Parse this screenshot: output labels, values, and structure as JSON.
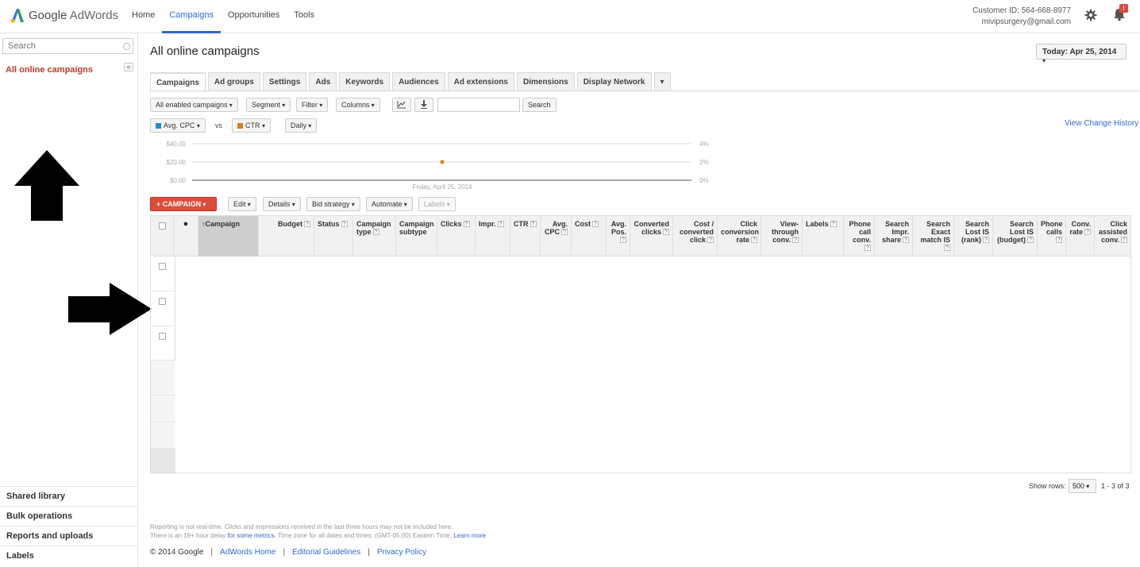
{
  "app": {
    "logo_text": "Google AdWords",
    "logo_text_a": "Google",
    "logo_text_b": " AdWords"
  },
  "topnav": {
    "home": "Home",
    "campaigns": "Campaigns",
    "opportunities": "Opportunities",
    "tools": "Tools"
  },
  "account": {
    "customer_id": "Customer ID: 564-668-8977",
    "email": "mivipsurgery@gmail.com",
    "notification_badge": "!"
  },
  "sidebar": {
    "search_placeholder": "Search",
    "collapse_label": "«",
    "all_campaigns": "All online campaigns",
    "shared_library": "Shared library",
    "bulk_operations": "Bulk operations",
    "reports_uploads": "Reports and uploads",
    "labels": "Labels"
  },
  "main": {
    "title": "All online campaigns",
    "date_range": "Today: Apr 25, 2014",
    "tabs": [
      "Campaigns",
      "Ad groups",
      "Settings",
      "Ads",
      "Keywords",
      "Audiences",
      "Ad extensions",
      "Dimensions",
      "Display Network"
    ],
    "tab_more": "▾",
    "toolbar": {
      "filter_enabled": "All enabled campaigns",
      "segment": "Segment",
      "filter": "Filter",
      "columns": "Columns",
      "search_button": "Search"
    },
    "metrics": {
      "metric1": "Avg. CPC",
      "vs": "vs",
      "metric2": "CTR",
      "interval": "Daily"
    },
    "view_change_history": "View Change History",
    "actions": {
      "new_campaign": "+ CAMPAIGN",
      "edit": "Edit",
      "details": "Details",
      "bid_strategy": "Bid strategy",
      "automate": "Automate",
      "labels": "Labels"
    },
    "table": {
      "columns": {
        "campaign": "Campaign",
        "budget": "Budget",
        "status": "Status",
        "campaign_type": "Campaign type",
        "campaign_subtype": "Campaign subtype",
        "clicks": "Clicks",
        "impr": "Impr.",
        "ctr": "CTR",
        "avg_cpc": "Avg. CPC",
        "cost": "Cost",
        "avg_pos": "Avg. Pos.",
        "converted_clicks": "Converted clicks",
        "cost_converted_click": "Cost / converted click",
        "click_conversion_rate": "Click conversion rate",
        "view_through_conv": "View-through conv.",
        "labels": "Labels",
        "phone_call_conv": "Phone call conv.",
        "search_impr_share": "Search Impr. share",
        "search_exact_match_is": "Search Exact match IS",
        "search_lost_is_rank": "Search Lost IS (rank)",
        "search_lost_is_budget": "Search Lost IS (budget)",
        "phone_calls": "Phone calls",
        "conv_rate": "Conv. rate",
        "click_assisted_conv": "Click assisted conv."
      },
      "help": "?"
    },
    "pagination": {
      "show_rows_label": "Show rows:",
      "rows_value": "500",
      "range": "1 - 3 of 3"
    }
  },
  "footer": {
    "note1": "Reporting is not real-time. Clicks and impressions received in the last three hours may not be included here.",
    "note2a": "There is an 18+ hour delay",
    "note2b": "for some metrics.",
    "note2c": "Time zone for all dates and times: (GMT-05:00) Eastern Time.",
    "learn_more": "Learn more",
    "copyright": "© 2014 Google",
    "adwords_home": "AdWords Home",
    "editorial_guidelines": "Editorial Guidelines",
    "privacy_policy": "Privacy Policy",
    "separator": "|"
  },
  "chart_data": {
    "type": "line",
    "x_label": "Friday, April 25, 2014",
    "left_axis_ticks": [
      "$40.00",
      "$20.00",
      "$0.00"
    ],
    "right_axis_ticks": [
      "4%",
      "2%",
      "0%"
    ],
    "series": [
      {
        "name": "Avg. CPC",
        "color": "#1f8dd6",
        "values": []
      },
      {
        "name": "CTR",
        "color": "#e07a1f",
        "values": [
          2
        ]
      }
    ]
  }
}
